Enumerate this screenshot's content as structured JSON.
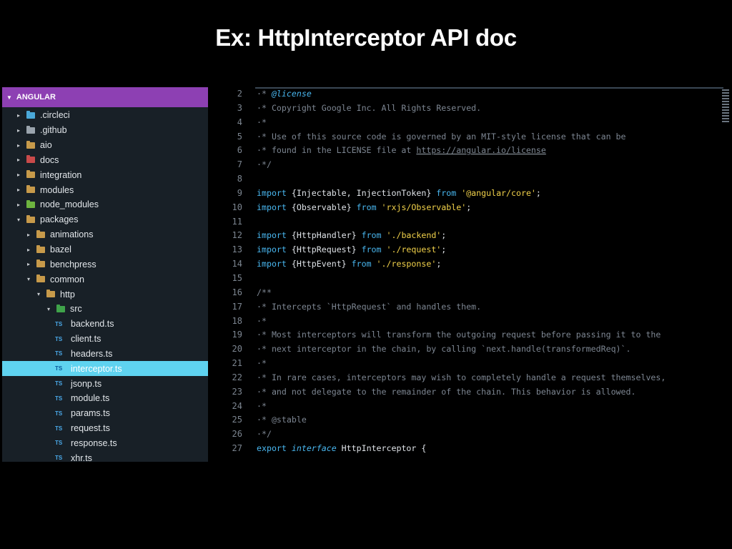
{
  "slide": {
    "title": "Ex: HttpInterceptor API doc"
  },
  "explorer": {
    "header": "ANGULAR",
    "items": [
      {
        "label": ".circleci",
        "indent": 0,
        "twisty": "▸",
        "icon": "blue"
      },
      {
        "label": ".github",
        "indent": 0,
        "twisty": "▸",
        "icon": "grey"
      },
      {
        "label": "aio",
        "indent": 0,
        "twisty": "▸",
        "icon": "folder"
      },
      {
        "label": "docs",
        "indent": 0,
        "twisty": "▸",
        "icon": "red"
      },
      {
        "label": "integration",
        "indent": 0,
        "twisty": "▸",
        "icon": "folder"
      },
      {
        "label": "modules",
        "indent": 0,
        "twisty": "▸",
        "icon": "folder"
      },
      {
        "label": "node_modules",
        "indent": 0,
        "twisty": "▸",
        "icon": "green"
      },
      {
        "label": "packages",
        "indent": 0,
        "twisty": "▾",
        "icon": "folder"
      },
      {
        "label": "animations",
        "indent": 1,
        "twisty": "▸",
        "icon": "folder"
      },
      {
        "label": "bazel",
        "indent": 1,
        "twisty": "▸",
        "icon": "folder"
      },
      {
        "label": "benchpress",
        "indent": 1,
        "twisty": "▸",
        "icon": "folder"
      },
      {
        "label": "common",
        "indent": 1,
        "twisty": "▾",
        "icon": "folder"
      },
      {
        "label": "http",
        "indent": 2,
        "twisty": "▾",
        "icon": "folder"
      },
      {
        "label": "src",
        "indent": 3,
        "twisty": "▾",
        "icon": "green2"
      },
      {
        "label": "backend.ts",
        "indent": 4,
        "twisty": "",
        "icon": "ts"
      },
      {
        "label": "client.ts",
        "indent": 4,
        "twisty": "",
        "icon": "ts"
      },
      {
        "label": "headers.ts",
        "indent": 4,
        "twisty": "",
        "icon": "ts"
      },
      {
        "label": "interceptor.ts",
        "indent": 4,
        "twisty": "",
        "icon": "ts",
        "selected": true
      },
      {
        "label": "jsonp.ts",
        "indent": 4,
        "twisty": "",
        "icon": "ts"
      },
      {
        "label": "module.ts",
        "indent": 4,
        "twisty": "",
        "icon": "ts"
      },
      {
        "label": "params.ts",
        "indent": 4,
        "twisty": "",
        "icon": "ts"
      },
      {
        "label": "request.ts",
        "indent": 4,
        "twisty": "",
        "icon": "ts"
      },
      {
        "label": "response.ts",
        "indent": 4,
        "twisty": "",
        "icon": "ts"
      },
      {
        "label": "xhr.ts",
        "indent": 4,
        "twisty": "",
        "icon": "ts"
      }
    ],
    "ts_badge": "TS"
  },
  "editor": {
    "lines": [
      {
        "n": "2",
        "tokens": [
          {
            "t": "·* ",
            "c": "cm"
          },
          {
            "t": "@license",
            "c": "kw it"
          }
        ]
      },
      {
        "n": "3",
        "tokens": [
          {
            "t": "·* Copyright Google Inc. All Rights Reserved.",
            "c": "cm"
          }
        ]
      },
      {
        "n": "4",
        "tokens": [
          {
            "t": "·*",
            "c": "cm"
          }
        ]
      },
      {
        "n": "5",
        "tokens": [
          {
            "t": "·* Use of this source code is governed by an MIT-style license that can be",
            "c": "cm"
          }
        ]
      },
      {
        "n": "6",
        "tokens": [
          {
            "t": "·* found in the LICENSE file at ",
            "c": "cm"
          },
          {
            "t": "https://angular.io/license",
            "c": "cm ul"
          }
        ]
      },
      {
        "n": "7",
        "tokens": [
          {
            "t": "·*/",
            "c": "cm"
          }
        ]
      },
      {
        "n": "8",
        "tokens": []
      },
      {
        "n": "9",
        "tokens": [
          {
            "t": "import",
            "c": "kw"
          },
          {
            "t": " {Injectable, InjectionToken} ",
            "c": ""
          },
          {
            "t": "from",
            "c": "kw"
          },
          {
            "t": " ",
            "c": ""
          },
          {
            "t": "'@angular/core'",
            "c": "str"
          },
          {
            "t": ";",
            "c": ""
          }
        ]
      },
      {
        "n": "10",
        "tokens": [
          {
            "t": "import",
            "c": "kw"
          },
          {
            "t": " {Observable} ",
            "c": ""
          },
          {
            "t": "from",
            "c": "kw"
          },
          {
            "t": " ",
            "c": ""
          },
          {
            "t": "'rxjs/Observable'",
            "c": "str"
          },
          {
            "t": ";",
            "c": ""
          }
        ]
      },
      {
        "n": "11",
        "tokens": []
      },
      {
        "n": "12",
        "tokens": [
          {
            "t": "import",
            "c": "kw"
          },
          {
            "t": " {HttpHandler} ",
            "c": ""
          },
          {
            "t": "from",
            "c": "kw"
          },
          {
            "t": " ",
            "c": ""
          },
          {
            "t": "'./backend'",
            "c": "str"
          },
          {
            "t": ";",
            "c": ""
          }
        ]
      },
      {
        "n": "13",
        "tokens": [
          {
            "t": "import",
            "c": "kw"
          },
          {
            "t": " {HttpRequest} ",
            "c": ""
          },
          {
            "t": "from",
            "c": "kw"
          },
          {
            "t": " ",
            "c": ""
          },
          {
            "t": "'./request'",
            "c": "str"
          },
          {
            "t": ";",
            "c": ""
          }
        ]
      },
      {
        "n": "14",
        "tokens": [
          {
            "t": "import",
            "c": "kw"
          },
          {
            "t": " {HttpEvent} ",
            "c": ""
          },
          {
            "t": "from",
            "c": "kw"
          },
          {
            "t": " ",
            "c": ""
          },
          {
            "t": "'./response'",
            "c": "str"
          },
          {
            "t": ";",
            "c": ""
          }
        ]
      },
      {
        "n": "15",
        "tokens": []
      },
      {
        "n": "16",
        "tokens": [
          {
            "t": "/**",
            "c": "cm"
          }
        ]
      },
      {
        "n": "17",
        "tokens": [
          {
            "t": "·* Intercepts `HttpRequest` and handles them.",
            "c": "cm"
          }
        ]
      },
      {
        "n": "18",
        "tokens": [
          {
            "t": "·*",
            "c": "cm"
          }
        ]
      },
      {
        "n": "19",
        "tokens": [
          {
            "t": "·* Most interceptors will transform the outgoing request before passing it to the",
            "c": "cm"
          }
        ]
      },
      {
        "n": "20",
        "tokens": [
          {
            "t": "·* next interceptor in the chain, by calling `next.handle(transformedReq)`.",
            "c": "cm"
          }
        ]
      },
      {
        "n": "21",
        "tokens": [
          {
            "t": "·*",
            "c": "cm"
          }
        ]
      },
      {
        "n": "22",
        "tokens": [
          {
            "t": "·* In rare cases, interceptors may wish to completely handle a request themselves,",
            "c": "cm"
          }
        ]
      },
      {
        "n": "23",
        "tokens": [
          {
            "t": "·* and not delegate to the remainder of the chain. This behavior is allowed.",
            "c": "cm"
          }
        ]
      },
      {
        "n": "24",
        "tokens": [
          {
            "t": "·*",
            "c": "cm"
          }
        ]
      },
      {
        "n": "25",
        "tokens": [
          {
            "t": "·* @stable",
            "c": "cm"
          }
        ]
      },
      {
        "n": "26",
        "tokens": [
          {
            "t": "·*/",
            "c": "cm"
          }
        ]
      },
      {
        "n": "27",
        "tokens": [
          {
            "t": "export",
            "c": "kw"
          },
          {
            "t": " ",
            "c": ""
          },
          {
            "t": "interface",
            "c": "kw it"
          },
          {
            "t": " HttpInterceptor {",
            "c": ""
          }
        ]
      }
    ]
  }
}
